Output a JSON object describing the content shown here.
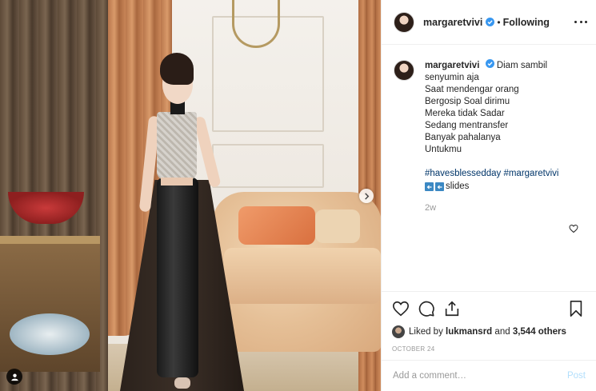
{
  "post": {
    "username": "margaretvivi",
    "follow_status": "Following",
    "caption_lines": [
      "Diam sambil",
      "senyumin aja",
      "Saat mendengar orang",
      "Bergosip Soal dirimu",
      "Mereka tidak Sadar",
      "Sedang mentransfer",
      "Banyak pahalanya",
      "Untukmu"
    ],
    "hashtags": "#havesblessedday #margaretvivi",
    "slides_label": "slides",
    "time_ago": "2w",
    "liked_by_prefix": "Liked by",
    "liked_by_user": "lukmansrd",
    "liked_by_and": "and",
    "liked_by_others": "3,544 others",
    "date": "OCTOBER 24",
    "comment_placeholder": "Add a comment…",
    "post_label": "Post"
  },
  "colors": {
    "verified": "#3897f0",
    "hashtag": "#003569",
    "post_disabled": "#b2dffc",
    "slides_icon": "#3b88c3"
  },
  "icons": {
    "verified": "verified-badge-icon",
    "more": "more-options-icon",
    "next": "chevron-right-icon",
    "tag": "user-tag-icon",
    "heart": "heart-icon",
    "comment": "comment-icon",
    "share": "share-icon",
    "save": "bookmark-icon"
  }
}
